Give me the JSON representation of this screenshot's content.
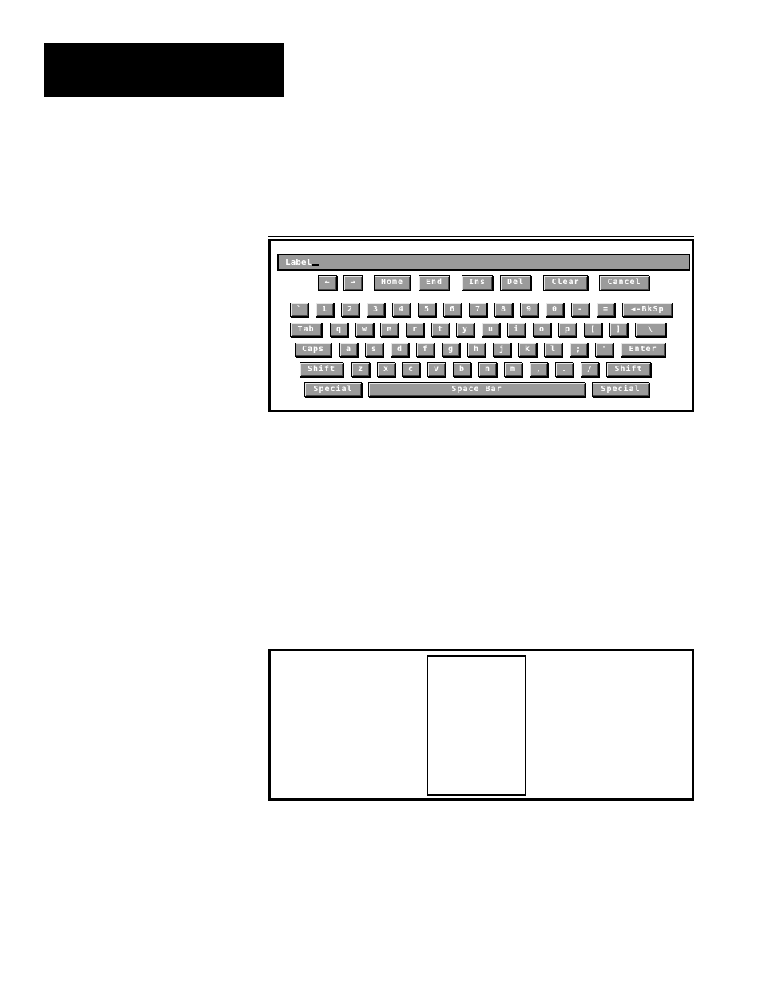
{
  "header": {
    "color": "#000000"
  },
  "keyboard": {
    "field": {
      "value": "Label",
      "cursor": "_"
    },
    "nav_keys": [
      {
        "label": "←",
        "name": "left-arrow-key"
      },
      {
        "label": "→",
        "name": "right-arrow-key"
      },
      {
        "label": "Home",
        "name": "home-key"
      },
      {
        "label": "End",
        "name": "end-key"
      },
      {
        "label": "Ins",
        "name": "ins-key"
      },
      {
        "label": "Del",
        "name": "del-key"
      },
      {
        "label": "Clear",
        "name": "clear-key"
      },
      {
        "label": "Cancel",
        "name": "cancel-key"
      }
    ],
    "rows": [
      [
        "`",
        "1",
        "2",
        "3",
        "4",
        "5",
        "6",
        "7",
        "8",
        "9",
        "0",
        "-",
        "=",
        "◄-BkSp"
      ],
      [
        "Tab",
        "q",
        "w",
        "e",
        "r",
        "t",
        "y",
        "u",
        "i",
        "o",
        "p",
        "[",
        "]",
        "\\"
      ],
      [
        "Caps",
        "a",
        "s",
        "d",
        "f",
        "g",
        "h",
        "j",
        "k",
        "l",
        ";",
        "'",
        "Enter"
      ],
      [
        "Shift",
        "z",
        "x",
        "c",
        "v",
        "b",
        "n",
        "m",
        ",",
        ".",
        "/",
        "Shift"
      ],
      [
        "Special",
        "Space Bar",
        "Special"
      ]
    ],
    "colors": {
      "key_face": "#9b9b9b",
      "key_text": "#ffffff",
      "field_bg": "#9a9a9a"
    }
  }
}
